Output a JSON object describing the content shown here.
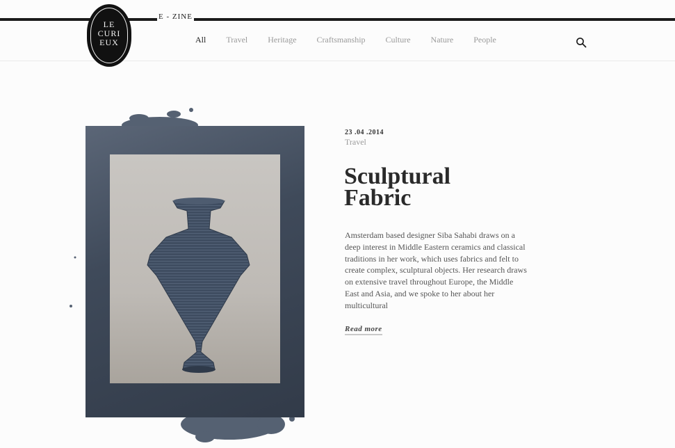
{
  "header": {
    "logo": {
      "lines": [
        "LE",
        "CURI",
        "EUX"
      ],
      "label": "LE CURIEUX"
    },
    "section_label": "E - ZINE",
    "nav": [
      {
        "label": "All",
        "active": true
      },
      {
        "label": "Travel",
        "active": false
      },
      {
        "label": "Heritage",
        "active": false
      },
      {
        "label": "Craftsmanship",
        "active": false
      },
      {
        "label": "Culture",
        "active": false
      },
      {
        "label": "Nature",
        "active": false
      },
      {
        "label": "People",
        "active": false
      }
    ],
    "search_icon": "search-icon"
  },
  "article": {
    "date": "23 .04 .2014",
    "category": "Travel",
    "title_line1": "Sculptural",
    "title_line2": "Fabric",
    "excerpt": "Amsterdam based designer Siba Sahabi draws on a deep interest in Middle Eastern ceramics and classical traditions in her work, which uses fabrics and felt to create complex, sculptural objects. Her research draws on extensive travel throughout Europe, the Middle East and Asia, and we spoke to her about her multicultural",
    "read_more": "Read more",
    "image": "sculptural-fabric-vase-photo"
  },
  "colors": {
    "background": "#fcfcfc",
    "text_dark": "#2a2a2a",
    "nav_inactive": "#9a9a9a",
    "ink_blue": "#38465a"
  }
}
